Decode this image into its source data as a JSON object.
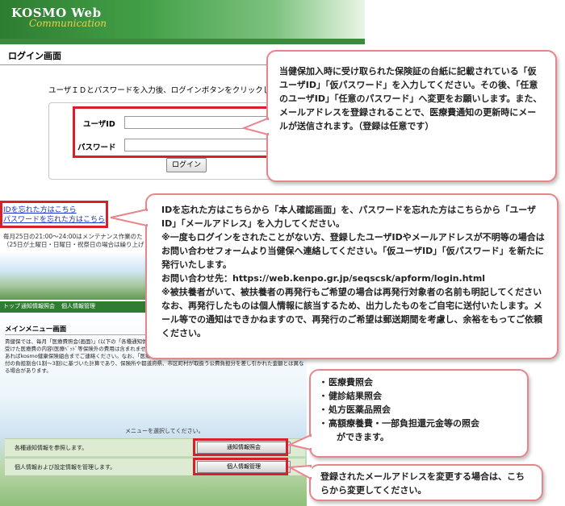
{
  "login_screen": {
    "brand": "KOSMO Web",
    "brand_sub": "Communication",
    "page_title": "ログイン画面",
    "instruction": "ユーザＩＤとパスワードを入力後、ログインボタンをクリックして",
    "userid_label": "ユーザID",
    "password_label": "パスワード",
    "login_button": "ログイン",
    "forgot_id_link": "IDを忘れた方はこちら",
    "forgot_password_link": "パスワードを忘れた方はこちら",
    "maintenance_line1": "毎月25日の21:00～24:00はメンテナンス作業のた",
    "maintenance_line2": "（25日が土曜日・日曜日・祝祭日の場合は繰り上げ"
  },
  "menu_screen": {
    "tabs": [
      "トップ",
      "通知情報照会",
      "個人情報管理"
    ],
    "title": "メインメニュー画面",
    "description": "貴健保では、毎月「医療費照会(画面)」(以下の「各種通知情報照会」) 健保険者(本人)や被扶養者(家族)の方が健康保険で診療を受けた医療費の内容(医療ﾍﾞｯﾄﾞ等保険外の費用は含まれません)をお知らせします。ご確認ください。受診した覚えのない請求があればkosmo健康保険組合までご連絡ください。なお、「医療費照会画面」に掲載している「あなたが支払った額」は、法定給付の負担割合(1割～3割)に基づいた計算であり、保険所や都道府県、市区町村が取扱う公費負担分を差し引かれた金額とは異なる場合があります。",
    "select_prompt": "メニューを選択してください。",
    "rows": [
      {
        "label": "各種通知情報を参照します。",
        "button": "通知情報照会"
      },
      {
        "label": "個人情報および設定情報を管理します。",
        "button": "個人情報管理"
      }
    ]
  },
  "callouts": {
    "temp_id": "当健保加入時に受け取られた保険証の台紙に記載されている「仮ユーザID」「仮パスワード」を入力してください。その後、「任意のユーザID」「任意のパスワード」へ変更をお願いします。また、メールアドレスを登録されることで、医療費通知の更新時にメールが送信されます。（登録は任意です）",
    "forgot": {
      "line1": "IDを忘れた方はこちらから「本人確認画面」を、パスワードを忘れた方はこちらから「ユーザID」「メールアドレス」を入力してください。",
      "line2": "※一度もログインをされたことがない方、登録したユーザIDやメールアドレスが不明等の場合はお問い合わせフォームより当健保へ連絡してください。「仮ユーザID」「仮パスワード」を新たに発行いたします。",
      "line3": "お問い合わせ先：https://web.kenpo.gr.jp/seqscsk/apform/login.html",
      "line4": "※被扶養者がいて、被扶養者の再発行もご希望の場合は再発行対象者の名前も明記してください",
      "line5": "なお、再発行したものは個人情報に該当するため、出力したものをご自宅に送付いたします。メール等での通知はできかねますので、再発行のご希望は郵送期間を考慮し、余裕をもってご依頼ください。"
    },
    "notice_items": [
      "医療費照会",
      "健診結果照会",
      "処方医薬品照会",
      "高額療養費・一部負担還元金等の照会"
    ],
    "notice_tail": "ができます。",
    "personal": "登録されたメールアドレスを変更する場合は、こちらから変更してください。"
  },
  "colors": {
    "header_green": "#2e7d32",
    "highlight_red": "#d8202a",
    "callout_border": "#e8858b",
    "link_blue": "#1a33cc"
  }
}
